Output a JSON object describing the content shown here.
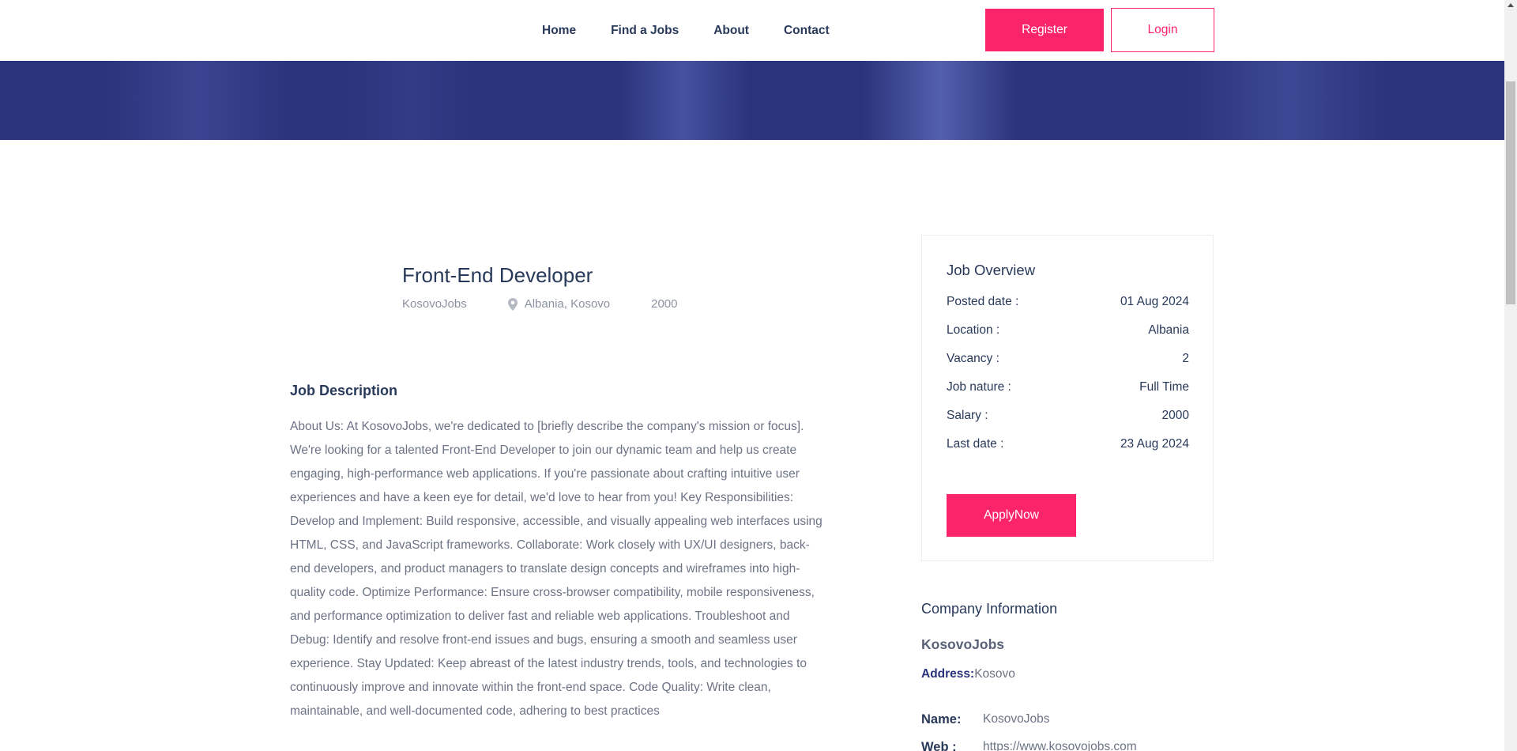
{
  "header": {
    "nav": [
      "Home",
      "Find a Jobs",
      "About",
      "Contact"
    ],
    "register_label": "Register",
    "login_label": "Login"
  },
  "job": {
    "title": "Front-End Developer",
    "company": "KosovoJobs",
    "location": "Albania, Kosovo",
    "salary": "2000"
  },
  "description": {
    "title": "Job Description",
    "text": "About Us: At KosovoJobs, we're dedicated to [briefly describe the company's mission or focus]. We're looking for a talented Front-End Developer to join our dynamic team and help us create engaging, high-performance web applications. If you're passionate about crafting intuitive user experiences and have a keen eye for detail, we'd love to hear from you! Key Responsibilities: Develop and Implement: Build responsive, accessible, and visually appealing web interfaces using HTML, CSS, and JavaScript frameworks. Collaborate: Work closely with UX/UI designers, back-end developers, and product managers to translate design concepts and wireframes into high-quality code. Optimize Performance: Ensure cross-browser compatibility, mobile responsiveness, and performance optimization to deliver fast and reliable web applications. Troubleshoot and Debug: Identify and resolve front-end issues and bugs, ensuring a smooth and seamless user experience. Stay Updated: Keep abreast of the latest industry trends, tools, and technologies to continuously improve and innovate within the front-end space. Code Quality: Write clean, maintainable, and well-documented code, adhering to best practices"
  },
  "overview": {
    "title": "Job Overview",
    "rows": [
      {
        "label": "Posted date :",
        "value": "01 Aug 2024"
      },
      {
        "label": "Location :",
        "value": "Albania"
      },
      {
        "label": "Vacancy :",
        "value": "2"
      },
      {
        "label": "Job nature :",
        "value": "Full Time"
      },
      {
        "label": "Salary :",
        "value": "2000"
      },
      {
        "label": "Last date :",
        "value": "23 Aug 2024"
      }
    ],
    "apply_label": "ApplyNow"
  },
  "company_info": {
    "title": "Company Information",
    "name": "KosovoJobs",
    "address_label": "Address:",
    "address_value": "Kosovo",
    "name_label": "Name:",
    "name_value": "KosovoJobs",
    "web_label": "Web :",
    "web_value": "https://www.kosovojobs.com"
  },
  "colors": {
    "accent": "#fb246a",
    "hero": "#2a337b",
    "heading": "#28395a"
  },
  "icons": [
    "location-pin-icon",
    "scroll-up-arrow-icon"
  ]
}
